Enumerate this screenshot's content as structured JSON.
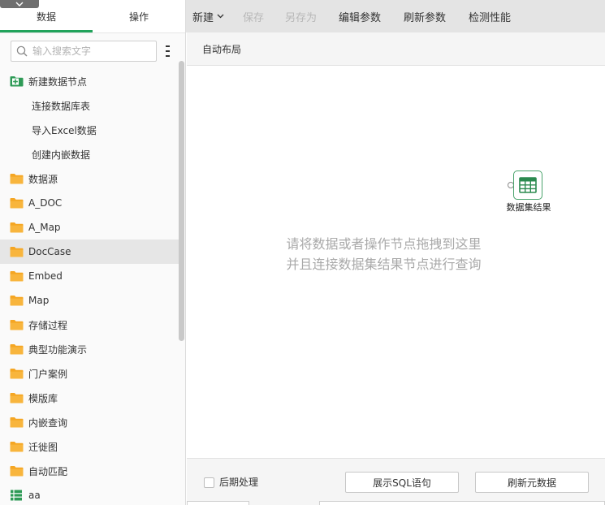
{
  "left_tabs": {
    "data": "数据",
    "operation": "操作"
  },
  "search": {
    "placeholder": "输入搜索文字"
  },
  "tree": [
    {
      "label": "新建数据节点",
      "icon": "add-folder-icon",
      "level": 0
    },
    {
      "label": "连接数据库表",
      "icon": "",
      "level": 1
    },
    {
      "label": "导入Excel数据",
      "icon": "",
      "level": 1
    },
    {
      "label": "创建内嵌数据",
      "icon": "",
      "level": 1
    },
    {
      "label": "数据源",
      "icon": "folder-icon",
      "level": 0
    },
    {
      "label": "A_DOC",
      "icon": "folder-icon",
      "level": 0
    },
    {
      "label": "A_Map",
      "icon": "folder-icon",
      "level": 0
    },
    {
      "label": "DocCase",
      "icon": "folder-icon",
      "level": 0,
      "selected": true
    },
    {
      "label": "Embed",
      "icon": "folder-icon",
      "level": 0
    },
    {
      "label": "Map",
      "icon": "folder-icon",
      "level": 0
    },
    {
      "label": "存储过程",
      "icon": "folder-icon",
      "level": 0
    },
    {
      "label": "典型功能演示",
      "icon": "folder-icon",
      "level": 0
    },
    {
      "label": "门户案例",
      "icon": "folder-icon",
      "level": 0
    },
    {
      "label": "模版库",
      "icon": "folder-icon",
      "level": 0
    },
    {
      "label": "内嵌查询",
      "icon": "folder-icon",
      "level": 0
    },
    {
      "label": "迁徙图",
      "icon": "folder-icon",
      "level": 0
    },
    {
      "label": "自动匹配",
      "icon": "folder-icon",
      "level": 0
    },
    {
      "label": "aa",
      "icon": "dataset-table-icon",
      "level": 0
    }
  ],
  "toolbar": {
    "new": "新建",
    "save": "保存",
    "save_as": "另存为",
    "edit_params": "编辑参数",
    "refresh_params": "刷新参数",
    "check_performance": "检测性能"
  },
  "subbar": {
    "auto_layout": "自动布局"
  },
  "canvas": {
    "result_node_label": "数据集结果",
    "hint_line1": "请将数据或者操作节点拖拽到这里",
    "hint_line2": "并且连接数据集结果节点进行查询"
  },
  "bottom": {
    "post_process": "后期处理",
    "show_sql": "展示SQL语句",
    "refresh_metadata": "刷新元数据"
  },
  "colors": {
    "accent_green": "#21a35b",
    "folder_orange": "#f5a623",
    "toolbar_bg": "#e4e4e4",
    "selected_row": "#e6e6e6",
    "hint_text": "#a9a9a9"
  }
}
